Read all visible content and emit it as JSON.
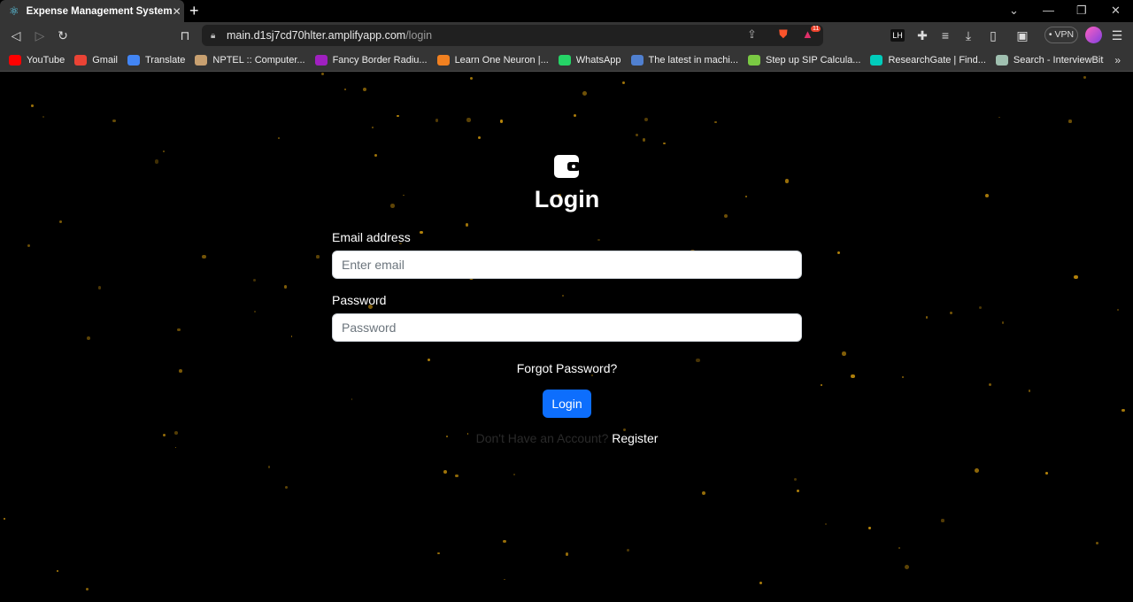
{
  "browser": {
    "tab_title": "Expense Management System",
    "url_host": "main.d1sj7cd70hlter.amplifyapp.com",
    "url_path": "/login",
    "brave_badge_count": "11",
    "vpn_label": "VPN",
    "extension_label": "LH",
    "bookmarks": [
      {
        "label": "YouTube",
        "color": "#ff0000"
      },
      {
        "label": "Gmail",
        "color": "#ea4335"
      },
      {
        "label": "Translate",
        "color": "#4285f4"
      },
      {
        "label": "NPTEL :: Computer...",
        "color": "#c8a070"
      },
      {
        "label": "Fancy Border Radiu...",
        "color": "#a020c0"
      },
      {
        "label": "Learn One Neuron |...",
        "color": "#f08020"
      },
      {
        "label": "WhatsApp",
        "color": "#25d366"
      },
      {
        "label": "The latest in machi...",
        "color": "#5080d0"
      },
      {
        "label": "Step up SIP Calcula...",
        "color": "#7ac943"
      },
      {
        "label": "ResearchGate | Find...",
        "color": "#00ccbb"
      },
      {
        "label": "Search - InterviewBit",
        "color": "#a0c0b0"
      }
    ],
    "overflow_label": "»"
  },
  "login": {
    "title": "Login",
    "email_label": "Email address",
    "email_placeholder": "Enter email",
    "email_value": "",
    "password_label": "Password",
    "password_placeholder": "Password",
    "password_value": "",
    "forgot_label": "Forgot Password?",
    "submit_label": "Login",
    "no_account_text": "Don't Have an Account?",
    "register_label": "Register"
  },
  "colors": {
    "primary": "#0d6efd",
    "background": "#000000",
    "particle": "#b8860b"
  }
}
